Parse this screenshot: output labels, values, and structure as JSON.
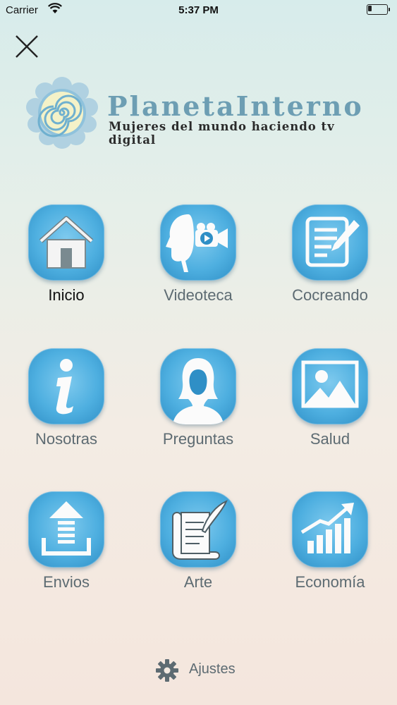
{
  "status_bar": {
    "carrier": "Carrier",
    "time": "5:37 PM"
  },
  "logo": {
    "title": "PlanetaInterno",
    "tagline": "Mujeres del mundo haciendo tv digital"
  },
  "menu": {
    "items": [
      {
        "label": "Inicio",
        "icon": "home-icon",
        "active": true
      },
      {
        "label": "Videoteca",
        "icon": "video-profile-icon"
      },
      {
        "label": "Cocreando",
        "icon": "document-edit-icon"
      },
      {
        "label": "Nosotras",
        "icon": "info-icon"
      },
      {
        "label": "Preguntas",
        "icon": "woman-silhouette-icon"
      },
      {
        "label": "Salud",
        "icon": "image-mountains-icon"
      },
      {
        "label": "Envios",
        "icon": "upload-icon"
      },
      {
        "label": "Arte",
        "icon": "scroll-quill-icon"
      },
      {
        "label": "Economía",
        "icon": "growth-chart-icon"
      }
    ]
  },
  "settings": {
    "label": "Ajustes",
    "icon": "gear-icon"
  },
  "colors": {
    "tile_blue": "#4eafe0",
    "logo_blue": "#6d9eb3",
    "label_gray": "#5d6b72",
    "active_label": "#111111"
  }
}
